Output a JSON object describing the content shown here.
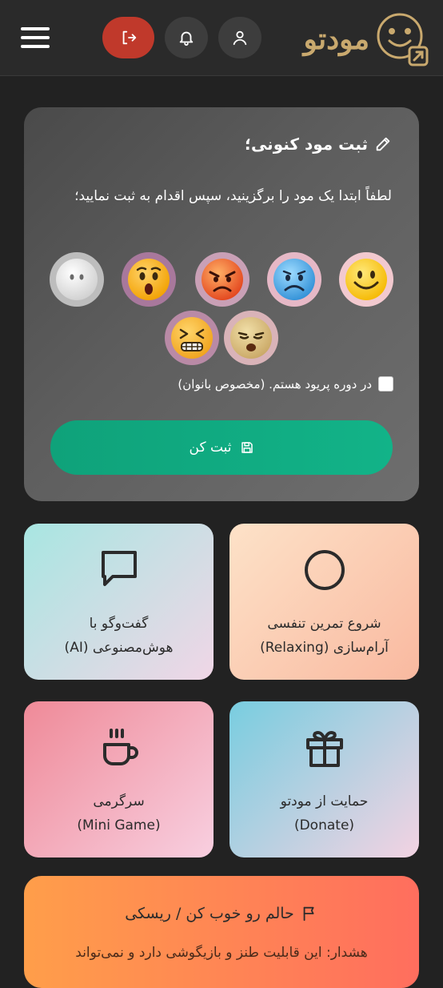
{
  "header": {
    "app_name": "مودتو",
    "logout_icon": "logout-icon",
    "bell_icon": "bell-icon",
    "user_icon": "user-icon",
    "menu_icon": "hamburger-icon",
    "accent_logout": "#c0392b",
    "brand_color": "#c9a96e"
  },
  "mood": {
    "title": "ثبت مود کنونی؛",
    "instruction": "لطفاً ابتدا یک مود را برگزینید، سپس اقدام به ثبت نمایید؛",
    "options": [
      {
        "name": "happy",
        "ring": "#f2c9cf"
      },
      {
        "name": "sad",
        "ring": "#e6b8c6"
      },
      {
        "name": "angry",
        "ring": "#c9a0b6"
      },
      {
        "name": "surprised",
        "ring": "#a8789c"
      },
      {
        "name": "neutral",
        "ring": "#bdbdbd"
      },
      {
        "name": "tired",
        "ring": "#d9b3b8"
      },
      {
        "name": "frustrated",
        "ring": "#b98aa6"
      }
    ],
    "period_label": "در دوره پریود هستم. (مخصوص بانوان)",
    "period_checked": false,
    "submit_label": "ثبت کن",
    "submit_color": "#12a983"
  },
  "tiles": {
    "breathing": {
      "line1": "شروع تمرین تنفسی",
      "line2": "آرام‌سازی (Relaxing)"
    },
    "chat": {
      "line1": "گفت‌وگو با",
      "line2": "هوش‌مصنوعی (AI)"
    },
    "donate": {
      "line1": "حمایت از مودتو",
      "line2": "(Donate)"
    },
    "game": {
      "line1": "سرگرمی",
      "line2": "(Mini Game)"
    }
  },
  "risk": {
    "title": "حالم رو خوب کن / ریسکی",
    "text": "هشدار: این قابلیت طنز و بازیگوشی دارد و نمی‌تواند"
  }
}
